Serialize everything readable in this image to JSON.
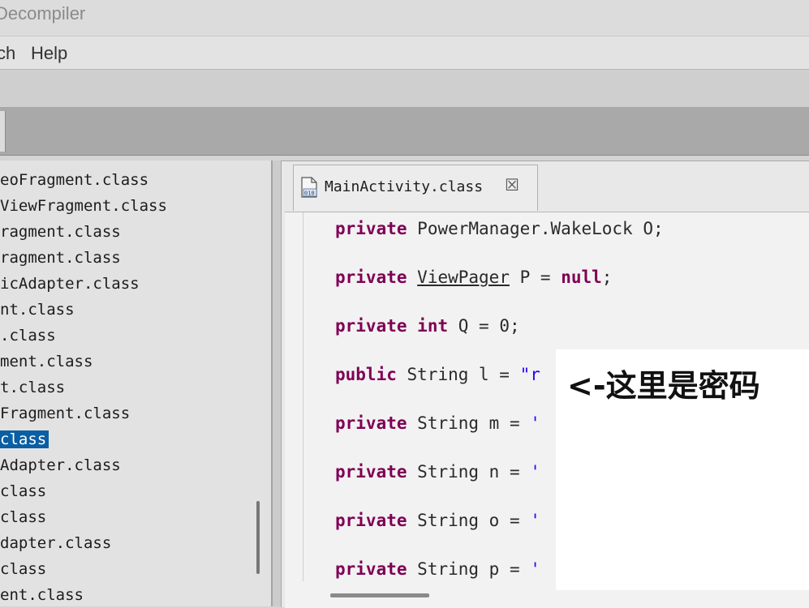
{
  "window": {
    "title": "Decompiler"
  },
  "menu": {
    "items": [
      "ch",
      "Help"
    ]
  },
  "tree": {
    "items": [
      {
        "label": "eoFragment.class",
        "selected": false
      },
      {
        "label": "ViewFragment.class",
        "selected": false
      },
      {
        "label": "ragment.class",
        "selected": false
      },
      {
        "label": "ragment.class",
        "selected": false
      },
      {
        "label": "icAdapter.class",
        "selected": false
      },
      {
        "label": "nt.class",
        "selected": false
      },
      {
        "label": ".class",
        "selected": false
      },
      {
        "label": "ment.class",
        "selected": false
      },
      {
        "label": "t.class",
        "selected": false
      },
      {
        "label": "Fragment.class",
        "selected": false
      },
      {
        "label": "class",
        "selected": true
      },
      {
        "label": "Adapter.class",
        "selected": false
      },
      {
        "label": "class",
        "selected": false
      },
      {
        "label": "class",
        "selected": false
      },
      {
        "label": "dapter.class",
        "selected": false
      },
      {
        "label": "class",
        "selected": false
      },
      {
        "label": "ent.class",
        "selected": false
      }
    ]
  },
  "editor": {
    "tab_label": "MainActivity.class",
    "tab_close_icon": "close-icon",
    "file_icon": "class-file-icon",
    "code_lines": [
      {
        "modifier": "private",
        "type": "PowerManager.WakeLock",
        "rest": " O;",
        "type_kind": "plain"
      },
      {
        "modifier": "private",
        "type": "ViewPager",
        "rest": " P = ",
        "value": "null",
        "value_kind": "kw",
        "tail": ";",
        "type_kind": "underline"
      },
      {
        "modifier": "private",
        "type": "int",
        "rest": " Q = 0;",
        "type_kind": "kw"
      },
      {
        "modifier": "public",
        "type": "String",
        "rest": " l = ",
        "value": "\"r",
        "value_kind": "str",
        "type_kind": "plain"
      },
      {
        "modifier": "private",
        "type": "String",
        "rest": " m = ",
        "value": "'",
        "value_kind": "str",
        "type_kind": "plain"
      },
      {
        "modifier": "private",
        "type": "String",
        "rest": " n = ",
        "value": "'",
        "value_kind": "str",
        "type_kind": "plain"
      },
      {
        "modifier": "private",
        "type": "String",
        "rest": " o = ",
        "value": "'",
        "value_kind": "str",
        "type_kind": "plain"
      },
      {
        "modifier": "private",
        "type": "String",
        "rest": " p = ",
        "value": "'",
        "value_kind": "str",
        "type_kind": "plain"
      }
    ]
  },
  "annotation": {
    "caption": "<-这里是密码"
  },
  "colors": {
    "keyword": "#7f0055",
    "string": "#2a00ff",
    "selection": "#0a5ea3"
  }
}
